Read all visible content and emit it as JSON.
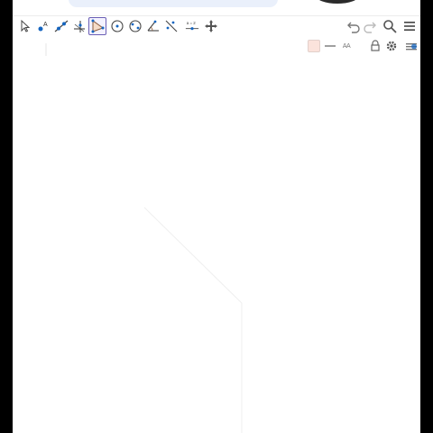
{
  "app": {
    "bg_color": "#ffffff",
    "outer_color": "#000000",
    "accent_color": "#6b5fb5",
    "icon_color": "#555555",
    "point_color": "#1565c0"
  },
  "toolbar": {
    "tools": [
      {
        "name": "move-tool-icon",
        "active": false
      },
      {
        "name": "point-tool-icon",
        "active": false
      },
      {
        "name": "line-tool-icon",
        "active": false
      },
      {
        "name": "perpendicular-line-tool-icon",
        "active": false
      },
      {
        "name": "polygon-tool-icon",
        "active": true
      },
      {
        "name": "circle-with-center-tool-icon",
        "active": false
      },
      {
        "name": "ellipse-tool-icon",
        "active": false
      },
      {
        "name": "angle-tool-icon",
        "active": false
      },
      {
        "name": "reflect-about-line-tool-icon",
        "active": false
      },
      {
        "name": "slider-tool-icon",
        "active": false
      },
      {
        "name": "move-graphics-view-tool-icon",
        "active": false
      }
    ],
    "slider_label": "a = 2",
    "right": [
      "undo-icon",
      "redo-icon",
      "search-icon",
      "menu-icon"
    ]
  },
  "stylebar": {
    "swatch_color": "#fbe3dc",
    "text_style_label": "AA",
    "items": [
      "color-swatch",
      "line-style-icon",
      "text-style-icon",
      "lock-icon",
      "settings-icon",
      "toggle-style-bar-icon"
    ]
  }
}
